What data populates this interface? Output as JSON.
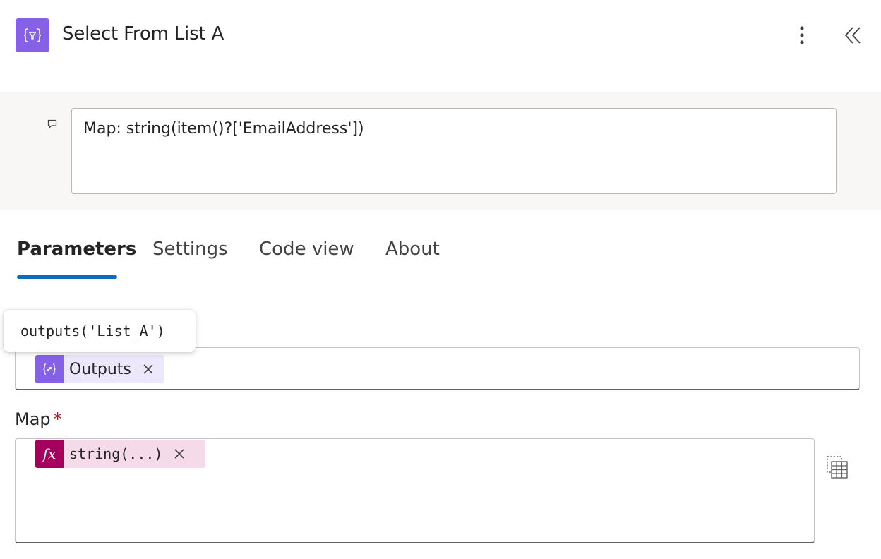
{
  "header": {
    "title": "Select From List A",
    "action_icon": "data-operation-icon",
    "more_icon": "more-vertical-icon",
    "collapse_icon": "chevron-double-left-icon"
  },
  "note": {
    "icon": "comment-icon",
    "text": "Map: string(item()?['EmailAddress'])"
  },
  "tabs": [
    {
      "label": "Parameters",
      "active": true
    },
    {
      "label": "Settings",
      "active": false
    },
    {
      "label": "Code view",
      "active": false
    },
    {
      "label": "About",
      "active": false
    }
  ],
  "tooltip": {
    "text": "outputs('List_A')"
  },
  "from_field": {
    "token": {
      "label": "Outputs",
      "icon": "data-operation-icon",
      "color": "#8661e8"
    }
  },
  "map_field": {
    "label": "Map",
    "required_mark": "*",
    "token": {
      "label": "string(...)",
      "icon": "fx-icon",
      "glyph": "fx",
      "color": "#a5005e"
    },
    "side_button_icon": "switch-to-table-icon"
  },
  "colors": {
    "accent": "#0f6cbd",
    "action_purple": "#8661e8",
    "expression_magenta": "#a5005e",
    "required_red": "#c50f1f"
  }
}
